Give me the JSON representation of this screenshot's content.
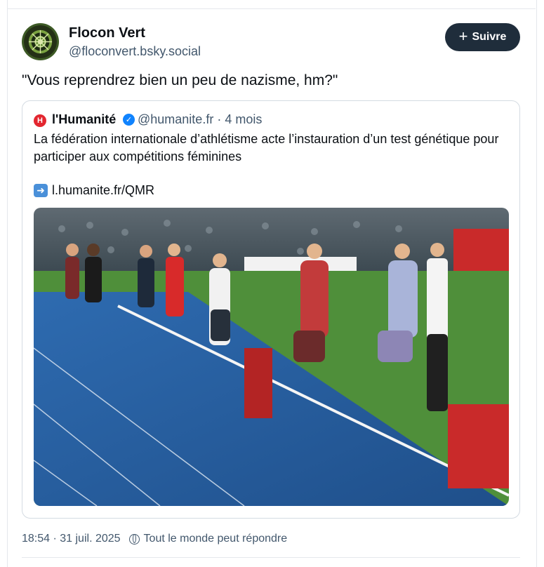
{
  "post": {
    "author_name": "Flocon Vert",
    "author_handle": "@floconvert.bsky.social",
    "follow_label": "Suivre",
    "text": "\"Vous reprendrez bien un peu de nazisme, hm?\"",
    "timestamp": "18:54 · 31 juil. 2025",
    "reply_setting": "Tout le monde peut répondre"
  },
  "quote": {
    "logo_letter": "H",
    "name": "l'Humanité",
    "handle": "@humanite.fr",
    "meta_sep": "·",
    "age": "4 mois",
    "text": "La fédération internationale d’athlétisme acte l’instauration d’un test génétique pour participer aux compétitions féminines",
    "link_icon": "right-arrow-emoji",
    "link": "l.humanite.fr/QMR"
  },
  "colors": {
    "follow_bg": "#1f2d3b",
    "secondary_text": "#42576c",
    "verified": "#1083fe",
    "brand_red": "#e3262f"
  }
}
